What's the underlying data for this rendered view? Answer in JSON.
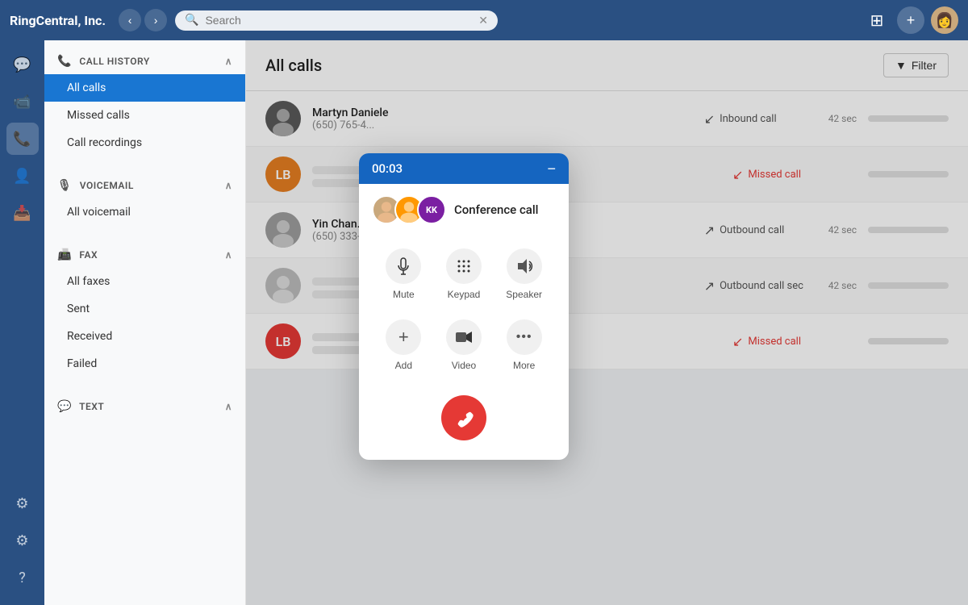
{
  "app": {
    "title": "RingCentral, Inc.",
    "search_placeholder": "Search"
  },
  "topbar": {
    "back_label": "‹",
    "forward_label": "›",
    "filter_label": "Filter",
    "apps_icon": "⊞",
    "add_icon": "+",
    "search_clear": "✕"
  },
  "sidebar": {
    "sections": [
      {
        "id": "call-history",
        "icon": "📞",
        "label": "CALL HISTORY",
        "items": [
          {
            "id": "all-calls",
            "label": "All calls",
            "active": true
          },
          {
            "id": "missed-calls",
            "label": "Missed calls"
          },
          {
            "id": "call-recordings",
            "label": "Call recordings"
          }
        ]
      },
      {
        "id": "voicemail",
        "icon": "🎙",
        "label": "VOICEMAIL",
        "items": [
          {
            "id": "all-voicemail",
            "label": "All voicemail"
          }
        ]
      },
      {
        "id": "fax",
        "icon": "📠",
        "label": "FAX",
        "items": [
          {
            "id": "all-faxes",
            "label": "All faxes"
          },
          {
            "id": "sent",
            "label": "Sent"
          },
          {
            "id": "received",
            "label": "Received"
          },
          {
            "id": "failed",
            "label": "Failed"
          }
        ]
      },
      {
        "id": "text",
        "icon": "💬",
        "label": "TEXT",
        "items": []
      }
    ]
  },
  "main": {
    "title": "All calls",
    "calls": [
      {
        "id": "row1",
        "name": "Martyn Daniele",
        "number": "(650) 765-4...",
        "type": "Inbound call",
        "type_class": "inbound",
        "duration": "42 sec",
        "avatar_bg": "#5a5a5a",
        "avatar_text": "",
        "avatar_type": "photo"
      },
      {
        "id": "row2",
        "name": "",
        "number": "",
        "type": "Missed call",
        "type_class": "missed",
        "duration": "",
        "avatar_bg": "#e67e22",
        "avatar_text": "LB"
      },
      {
        "id": "row3",
        "name": "Yin Chan...",
        "number": "(650) 333-...",
        "type": "Outbound call",
        "type_class": "outbound",
        "duration": "42 sec",
        "avatar_bg": "#8e8e8e",
        "avatar_text": "",
        "avatar_type": "photo"
      },
      {
        "id": "row4",
        "name": "",
        "number": "",
        "type": "Outbound call sec",
        "type_class": "outbound",
        "duration": "42 sec",
        "avatar_bg": "#9e9e9e",
        "avatar_text": "",
        "avatar_type": "photo"
      },
      {
        "id": "row5",
        "name": "",
        "number": "",
        "type": "Missed call",
        "type_class": "missed",
        "duration": "",
        "avatar_bg": "#e53935",
        "avatar_text": "LB"
      }
    ]
  },
  "conference": {
    "timer": "00:03",
    "label": "Conference call",
    "minimize_icon": "−",
    "controls": [
      {
        "id": "mute",
        "icon": "🎤",
        "label": "Mute"
      },
      {
        "id": "keypad",
        "icon": "⠿",
        "label": "Keypad"
      },
      {
        "id": "speaker",
        "icon": "🔊",
        "label": "Speaker"
      },
      {
        "id": "add",
        "icon": "+",
        "label": "Add"
      },
      {
        "id": "video",
        "icon": "📹",
        "label": "Video"
      },
      {
        "id": "more",
        "icon": "•••",
        "label": "More"
      }
    ],
    "end_call_icon": "📞"
  },
  "icons": {
    "chat": "💬",
    "video": "📹",
    "phone": "📞",
    "contacts": "👤",
    "inbox": "📥",
    "settings1": "⚙",
    "settings2": "⚙",
    "help": "?"
  }
}
